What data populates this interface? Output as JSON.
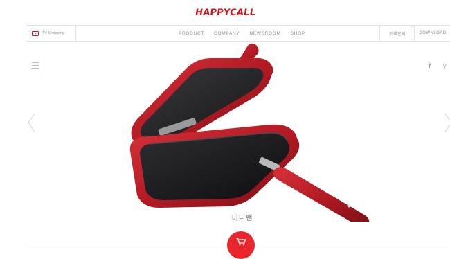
{
  "brand": {
    "logo_text": "HAPPYCALL"
  },
  "nav": {
    "tv_label": "TV Shopping",
    "menu": [
      "PRODUCT",
      "COMPANY",
      "NEWSROOM",
      "SHOP"
    ],
    "inquiry_label": "고객문의",
    "download_label": "DOWNLOAD"
  },
  "social": {
    "facebook": "f",
    "twitter": "y"
  },
  "product": {
    "name": "미니팬"
  },
  "colors": {
    "brand_red": "#c8161d",
    "cart_red": "#e8262b",
    "pan_red": "#b01c24",
    "pan_black": "#1b1b1d"
  },
  "icons": [
    "tv-play-icon",
    "hamburger-menu-icon",
    "facebook-icon",
    "twitter-icon",
    "chevron-left-icon",
    "chevron-right-icon",
    "cart-icon"
  ]
}
